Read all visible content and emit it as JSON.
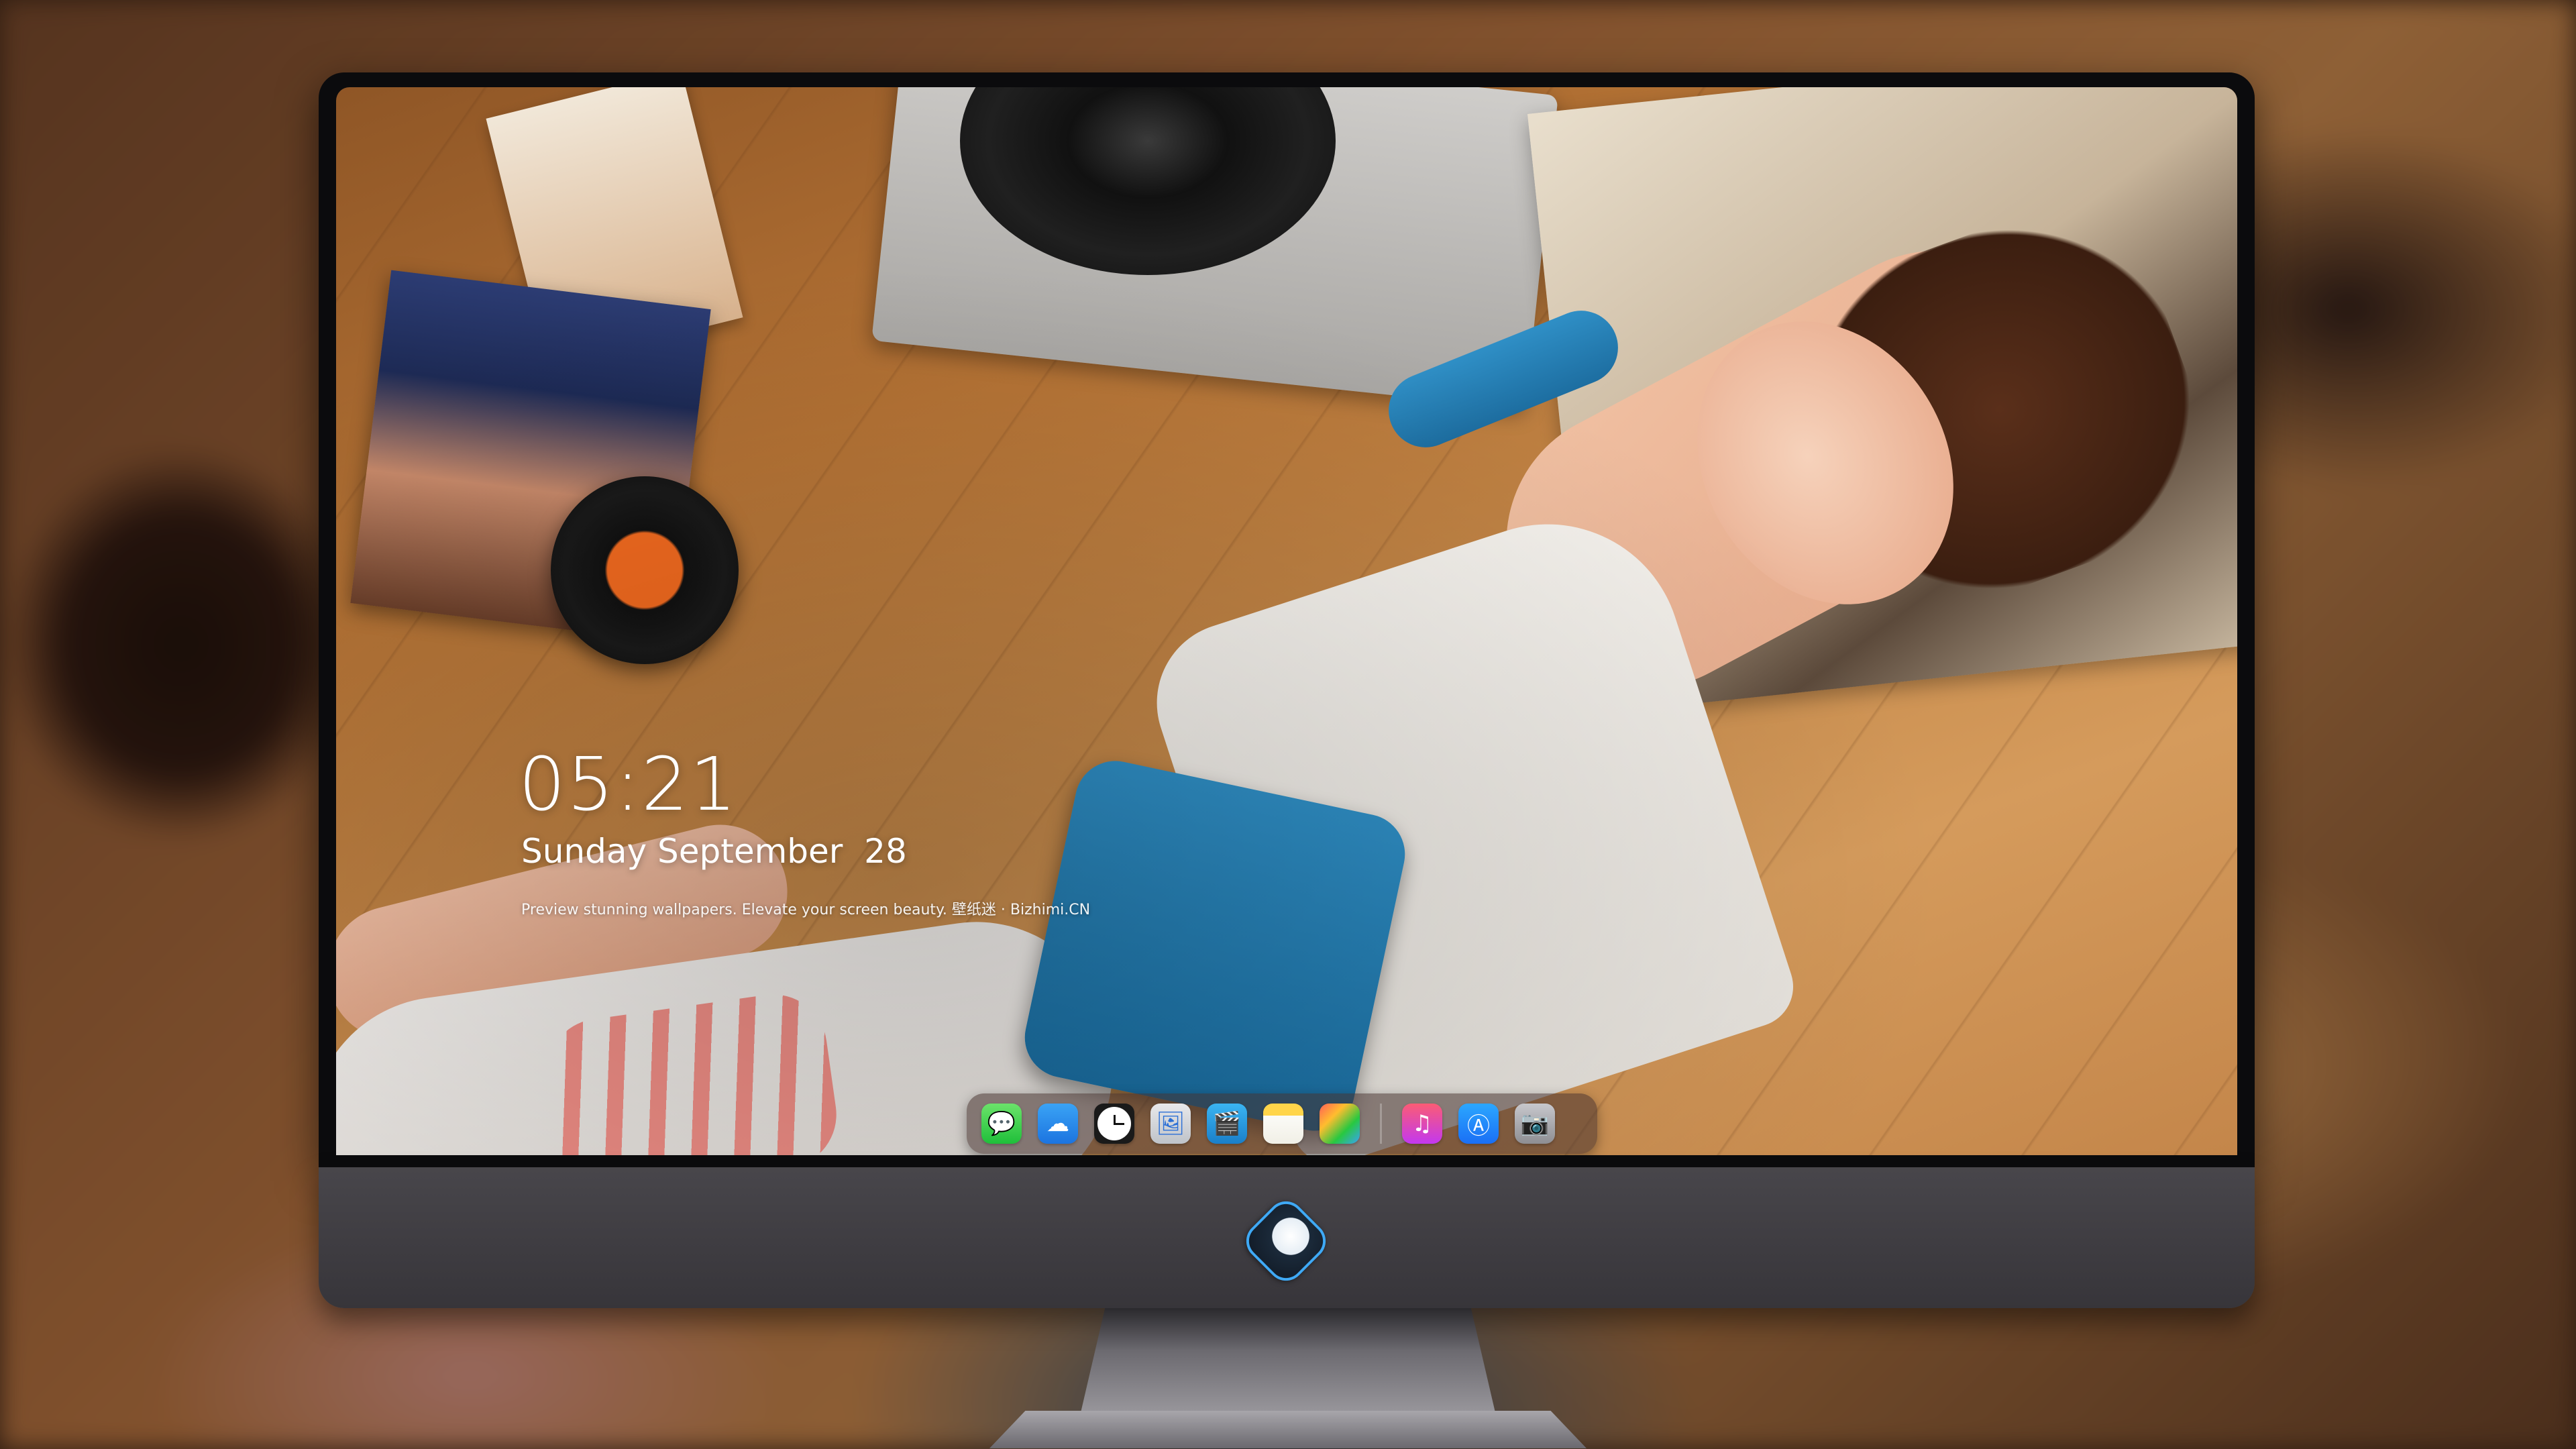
{
  "lock_screen": {
    "time": "05:21",
    "date": "Sunday September  28",
    "caption": "Preview stunning wallpapers. Elevate your screen beauty. 壁纸迷 · Bizhimi.CN"
  },
  "dock": {
    "apps": [
      {
        "name": "Messages",
        "icon": "messages-icon"
      },
      {
        "name": "Weather",
        "icon": "weather-icon"
      },
      {
        "name": "Clock",
        "icon": "clock-icon"
      },
      {
        "name": "Preview",
        "icon": "preview-icon"
      },
      {
        "name": "Clips",
        "icon": "clapperboard-icon"
      },
      {
        "name": "Notes",
        "icon": "notes-icon"
      },
      {
        "name": "Photos",
        "icon": "photos-icon"
      },
      {
        "name": "Music",
        "icon": "music-icon"
      },
      {
        "name": "App Store",
        "icon": "app-store-icon"
      },
      {
        "name": "Camera",
        "icon": "camera-icon"
      }
    ],
    "glyphs": {
      "messages": "💬",
      "weather": "☁",
      "preview": "🖼",
      "claquette": "🎬",
      "notes": "",
      "photos": "",
      "music": "♫",
      "appstore": "Ⓐ",
      "camera": "📷"
    }
  },
  "colors": {
    "accent_blue": "#3fa9f5",
    "monitor_chin": "#403e43",
    "bezel": "#0b0b0d"
  }
}
